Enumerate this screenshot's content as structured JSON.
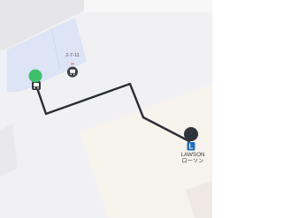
{
  "map": {
    "route_color": "#2c2f36",
    "origin_color": "#3fbf6a",
    "destination_color": "#2f333b",
    "store_brand_color": "#1e6fb8",
    "block_colors": {
      "road_light": "#f1f1f3",
      "shaded_block": "#e6e6e8",
      "grey_block": "#ececee",
      "highlight_block": "#dce4f6",
      "warm_block": "#f6f2ec"
    }
  },
  "markers": {
    "origin": {
      "icon": "location-pin-icon"
    },
    "origin_stop": {
      "icon": "bus-stop-icon"
    },
    "nearby_stop": {
      "icon": "bus-stop-icon",
      "label": "2-7-11"
    },
    "destination": {
      "icon": "lawson-store-icon",
      "label_line1": "LAWSON",
      "label_line2": "ローソン"
    }
  }
}
